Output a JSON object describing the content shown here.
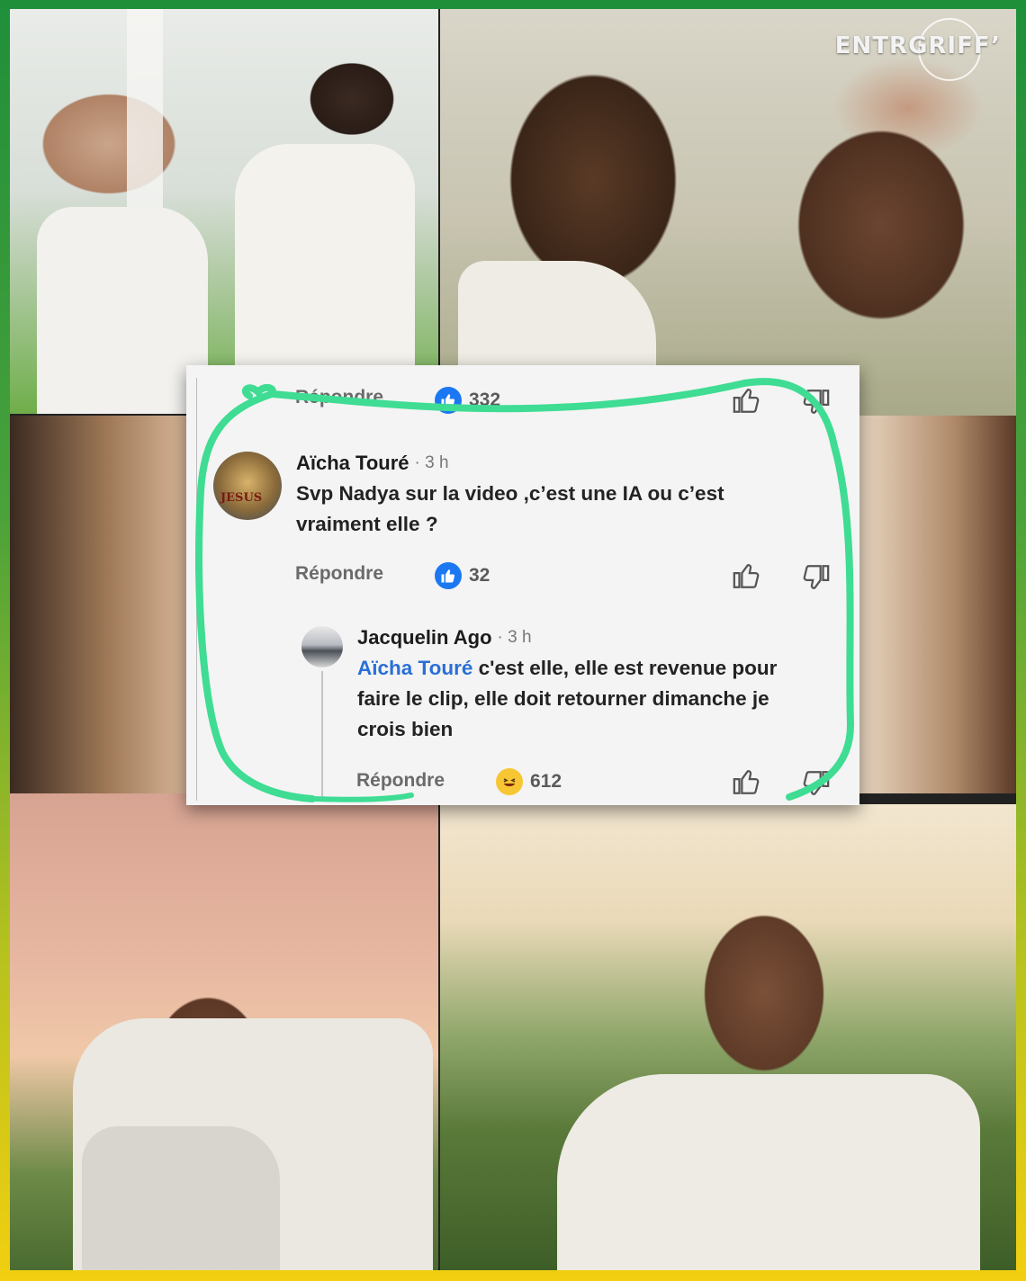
{
  "watermark": {
    "brand": "ENTRGRIFF’"
  },
  "colors": {
    "frame_top": "#1f8f3a",
    "frame_bottom": "#f2cf10",
    "highlight_scribble": "#3fdc93",
    "like_blue": "#1b78f2",
    "mention_blue": "#2a6fd6"
  },
  "comment_card": {
    "top_row": {
      "reply_label": "Répondre",
      "reaction_icon": "like-icon",
      "reaction_count": "332"
    },
    "comment": {
      "author": "Aïcha Touré",
      "time": "· 3 h",
      "text_line1": "Svp Nadya sur la video ,c’est une IA ou c’est",
      "text_line2": "vraiment elle ?",
      "avatar_text": "JESUS",
      "reply_label": "Répondre",
      "reaction_icon": "like-icon",
      "reaction_count": "32"
    },
    "reply": {
      "author": "Jacquelin Ago",
      "time": "· 3 h",
      "mention": "Aïcha Touré",
      "text_line1": " c'est elle, elle est revenue pour",
      "text_line2": "faire le clip, elle doit retourner dimanche je",
      "text_line3": "crois bien",
      "reply_label": "Répondre",
      "reaction_icon": "haha-icon",
      "reaction_count": "612"
    }
  }
}
